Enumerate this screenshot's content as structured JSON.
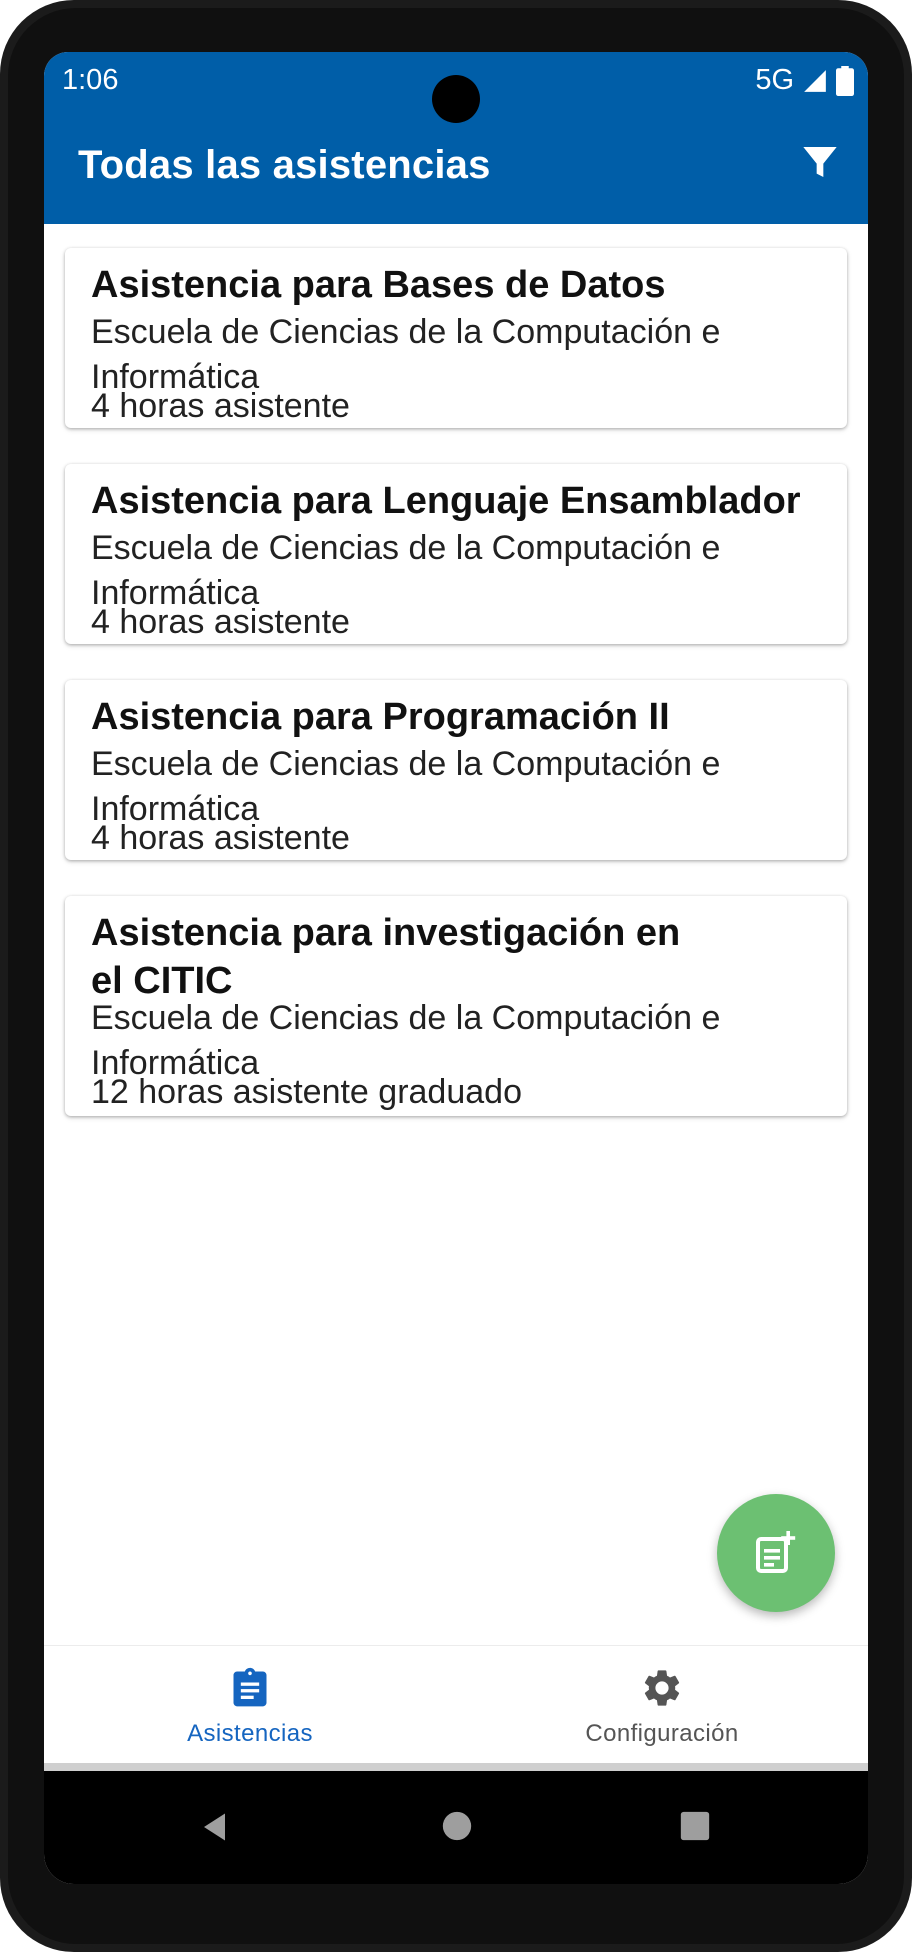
{
  "status_bar": {
    "time": "1:06",
    "network": "5G"
  },
  "app_bar": {
    "title": "Todas las asistencias"
  },
  "cards": [
    {
      "title": "Asistencia para Bases de Datos",
      "school": "Escuela de Ciencias de la Computación e Informática",
      "hours": "4 horas asistente"
    },
    {
      "title": "Asistencia para Lenguaje Ensamblador",
      "school": "Escuela de Ciencias de la Computación e Informática",
      "hours": "4 horas asistente"
    },
    {
      "title": "Asistencia para Programación II",
      "school": "Escuela de Ciencias de la Computación e Informática",
      "hours": "4 horas asistente"
    },
    {
      "title": "Asistencia para investigación en el CITIC",
      "school": "Escuela de Ciencias de la Computación e Informática",
      "hours": "12 horas asistente graduado"
    }
  ],
  "fab": {
    "icon": "add-note-icon"
  },
  "bottom_nav": {
    "items": [
      {
        "label": "Asistencias",
        "icon": "clipboard-icon",
        "active": true
      },
      {
        "label": "Configuración",
        "icon": "gear-icon",
        "active": false
      }
    ]
  },
  "colors": {
    "primary": "#005ea8",
    "fab": "#6cc072",
    "active_nav": "#1565c0",
    "inactive_nav": "#555555"
  },
  "system_nav": {
    "buttons": [
      "back-icon",
      "home-icon",
      "recents-icon"
    ]
  }
}
